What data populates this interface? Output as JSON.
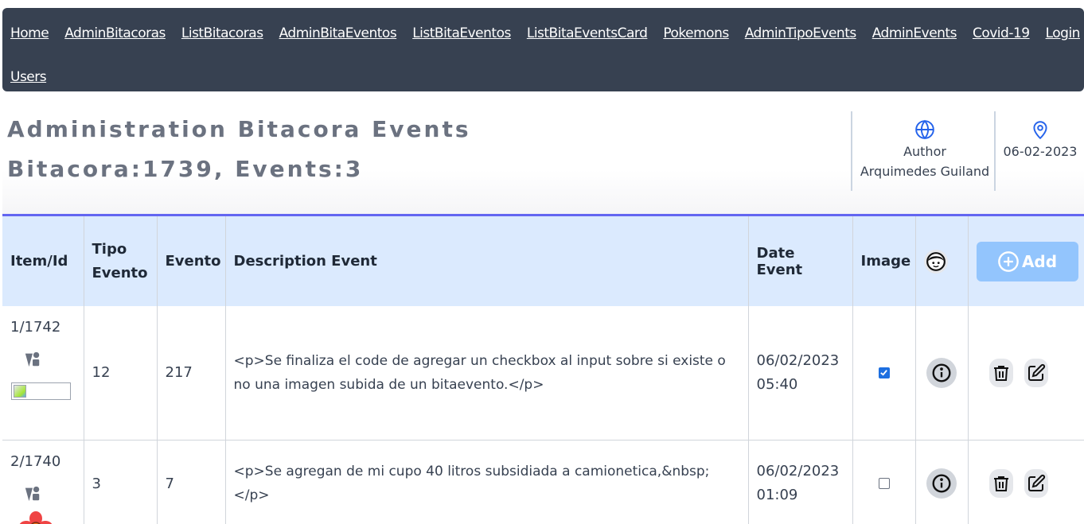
{
  "nav": {
    "row1": [
      "Home",
      "AdminBitacoras",
      "ListBitacoras",
      "AdminBitaEventos",
      "ListBitaEventos",
      "ListBitaEventsCard",
      "Pokemons",
      "AdminTipoEvents",
      "AdminEvents",
      "Covid-19",
      "Login"
    ],
    "row2": [
      "Users"
    ]
  },
  "header": {
    "title": "Administration Bitacora Events",
    "subtitle": "Bitacora:1739, Events:3",
    "author_label": "Author",
    "author_name": "Arquimedes Guiland",
    "date": "06-02-2023",
    "globe_icon": "globe-icon",
    "location_icon": "map-pin-icon"
  },
  "table": {
    "columns": [
      "Item/Id",
      "Tipo Evento",
      "Evento",
      "Description Event",
      "Date Event",
      "Image",
      "",
      ""
    ],
    "add_label": "Add",
    "rows": [
      {
        "item_id": "1/1742",
        "tipo": "12",
        "evento": "217",
        "description": "<p>Se finaliza el code de agregar un checkbox al input sobre si existe o no una imagen subida de un bitaevento.</p>",
        "date": "06/02/2023",
        "time": "05:40",
        "image": true
      },
      {
        "item_id": "2/1740",
        "tipo": "3",
        "evento": "7",
        "description": "<p>Se agregan de mi cupo 40 litros subsidiada a camionetica,&nbsp;</p>",
        "date": "06/02/2023",
        "time": "01:09",
        "image": false
      }
    ]
  },
  "colors": {
    "navbar": "#374151",
    "header_row": "#dbeafe",
    "accent_line": "#6366f1",
    "add_button": "#93c5fd",
    "checkbox": "#1d6fe0"
  }
}
